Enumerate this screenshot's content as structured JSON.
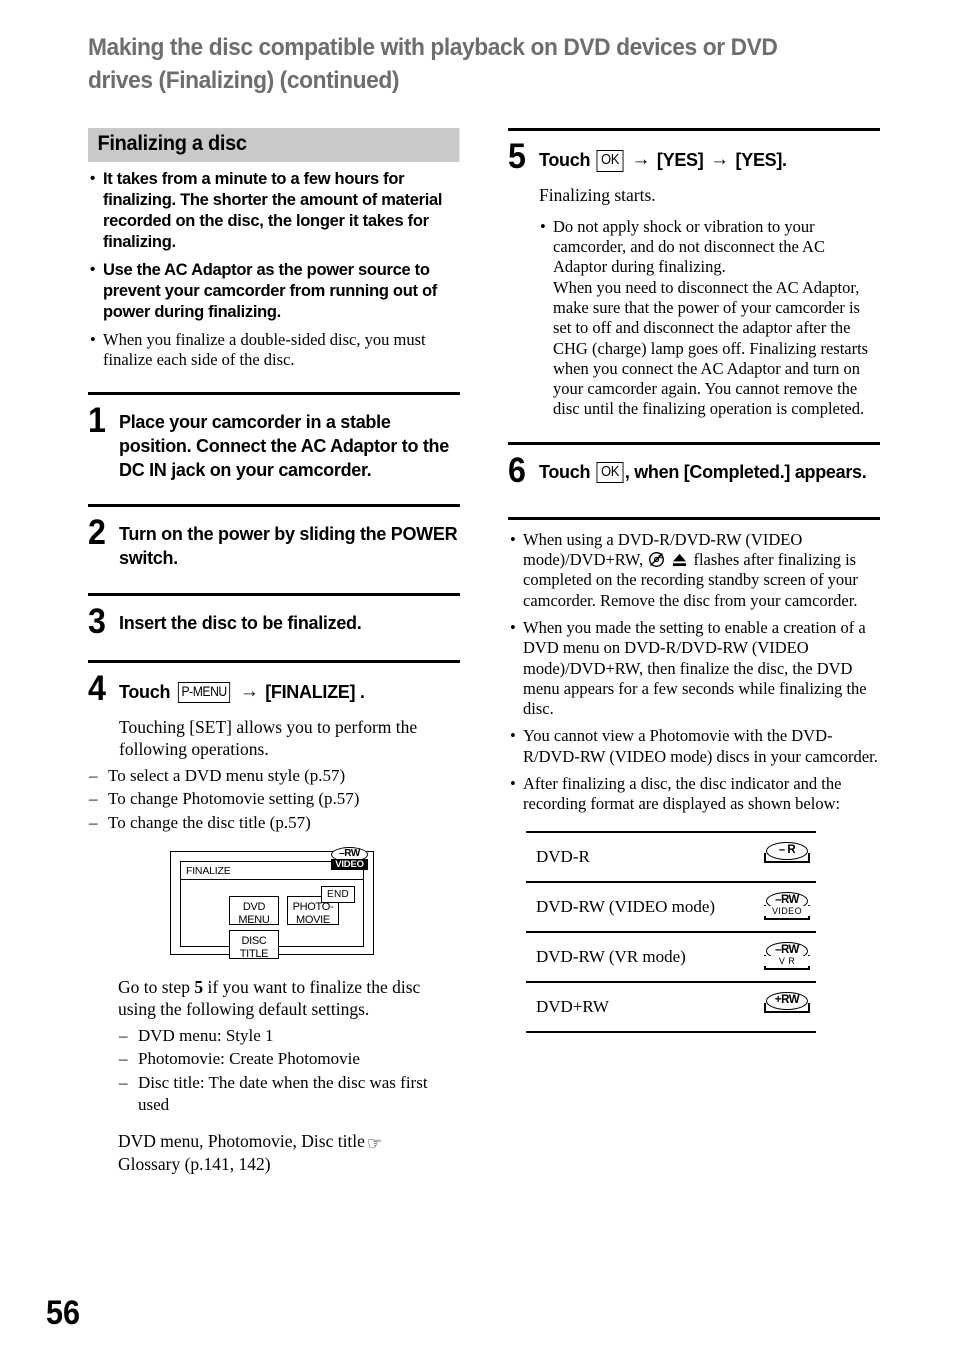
{
  "page": {
    "title": "Making the disc compatible with playback on DVD devices or DVD drives (Finalizing) (continued)",
    "number": "56",
    "header_band_color": "#c9c9c9",
    "title_color": "#6e6e6e"
  },
  "left_column": {
    "section_header": "Finalizing a disc",
    "intro_bullets_bold": [
      "It takes from a minute to a few hours for finalizing. The shorter the amount of material recorded on the disc, the longer it takes for finalizing.",
      "Use the AC Adaptor as the power source to prevent your camcorder from running out of power during finalizing."
    ],
    "intro_bullets_serif": [
      "When you finalize a double-sided disc, you must finalize each side of the disc."
    ],
    "steps": [
      {
        "number": "1",
        "text": "Place your camcorder in a stable position. Connect the AC Adaptor to the DC IN jack on your camcorder."
      },
      {
        "number": "2",
        "text": "Turn on the power by sliding the POWER switch."
      },
      {
        "number": "3",
        "text": "Insert the disc to be finalized."
      },
      {
        "number": "4",
        "prefix": "Touch",
        "key_label": "P-MENU",
        "arrow": "→",
        "suffix": "[FINALIZE] .",
        "body": "Touching [SET] allows you to perform the following operations.",
        "dash_items": [
          "To select a DVD menu style (p.57)",
          "To change Photomovie setting (p.57)",
          "To change the disc title (p.57)"
        ]
      }
    ],
    "lcd_diagram": {
      "title": "FINALIZE",
      "end_button": "END",
      "disc_oval": "–RW",
      "disc_sub": "VIDEO",
      "buttons": [
        "DVD\nMENU",
        "PHOTO-\nMOVIE",
        "DISC\nTITLE"
      ],
      "button_dvd_menu_line1": "DVD",
      "button_dvd_menu_line2": "MENU",
      "button_photomovie_line1": "PHOTO-",
      "button_photomovie_line2": "MOVIE",
      "button_disc_title_line1": "DISC",
      "button_disc_title_line2": "TITLE"
    },
    "goto_step_pre": "Go to step",
    "goto_step_num": "5",
    "goto_step_post": "if you want to finalize the disc using the following default settings.",
    "default_settings": [
      "DVD menu: Style 1",
      "Photomovie: Create Photomovie",
      "Disc title: The date when the disc was first used"
    ],
    "glossary_line1": "DVD menu, Photomovie, Disc title",
    "glossary_icon": "hand-pointing-icon",
    "glossary_line2": "Glossary (p.141, 142)"
  },
  "right_column": {
    "steps": [
      {
        "number": "5",
        "prefix": "Touch",
        "key_label": "OK",
        "arrow": "→",
        "middle": "[YES]",
        "suffix": "[YES].",
        "body": "Finalizing starts.",
        "bullets": [
          "Do not apply shock or vibration to your camcorder, and do not disconnect the AC Adaptor during finalizing.\nWhen you need to disconnect the AC Adaptor, make sure that the power of your camcorder is set to off and disconnect the adaptor after the CHG (charge) lamp goes off. Finalizing restarts when you connect the AC Adaptor and turn on your camcorder again. You cannot remove the disc until the finalizing operation is completed."
        ]
      },
      {
        "number": "6",
        "prefix": "Touch",
        "key_label": "OK",
        "suffix": ", when [Completed.] appears."
      }
    ],
    "notes": [
      {
        "pre": "When using a DVD-R/DVD-RW (VIDEO mode)/DVD+RW,",
        "icon1": "no-disc-icon",
        "icon2": "eject-icon",
        "post": "flashes after finalizing is completed on the recording standby screen of your camcorder. Remove the disc from your camcorder."
      },
      {
        "text": "When you made the setting to enable a creation of a DVD menu on DVD-R/DVD-RW (VIDEO mode)/DVD+RW, then finalize the disc, the DVD menu appears for a few seconds while finalizing the disc."
      },
      {
        "text": "You cannot view a Photomovie with the DVD-R/DVD-RW (VIDEO mode) discs in your camcorder."
      },
      {
        "text": "After finalizing a disc, the disc indicator and the recording format are displayed as shown below:"
      }
    ],
    "format_table": {
      "rows": [
        {
          "label": "DVD-R",
          "badge_oval": "– R",
          "badge_sub": ""
        },
        {
          "label": "DVD-RW (VIDEO mode)",
          "badge_oval": "–RW",
          "badge_sub": "VIDEO"
        },
        {
          "label": "DVD-RW (VR mode)",
          "badge_oval": "–RW",
          "badge_sub": "V R"
        },
        {
          "label": "DVD+RW",
          "badge_oval": "+RW",
          "badge_sub": ""
        }
      ]
    }
  }
}
